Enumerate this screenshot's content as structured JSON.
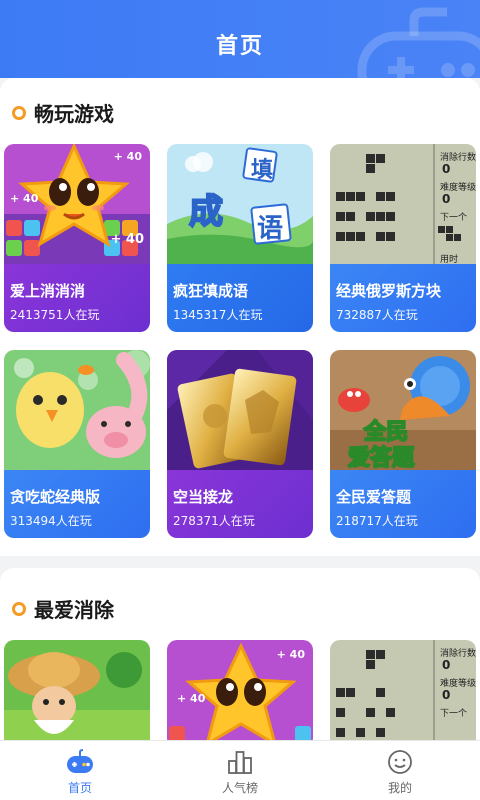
{
  "header": {
    "title": "首页"
  },
  "sections": [
    {
      "title": "畅玩游戏",
      "games": [
        {
          "name": "爱上消消消",
          "players": "2413751人在玩"
        },
        {
          "name": "疯狂填成语",
          "players": "1345317人在玩"
        },
        {
          "name": "经典俄罗斯方块",
          "players": "732887人在玩"
        },
        {
          "name": "贪吃蛇经典版",
          "players": "313494人在玩"
        },
        {
          "name": "空当接龙",
          "players": "278371人在玩"
        },
        {
          "name": "全民爱答题",
          "players": "218717人在玩"
        }
      ]
    },
    {
      "title": "最爱消除"
    }
  ],
  "art_text": {
    "plus40": "+ 40",
    "idiom": [
      "成",
      "填",
      "语"
    ],
    "tetris_labels": [
      "消除行数",
      "0",
      "难度等级",
      "0",
      "下一个",
      "用时"
    ],
    "quiz": [
      "全民",
      "爱答题"
    ]
  },
  "nav": [
    {
      "label": "首页",
      "icon": "gamepad-icon",
      "active": true
    },
    {
      "label": "人气榜",
      "icon": "bar-chart-icon",
      "active": false
    },
    {
      "label": "我的",
      "icon": "smiley-icon",
      "active": false
    }
  ],
  "colors": {
    "primary": "#3d7bf5",
    "accent": "#f59a23",
    "card_purple": "#7a33d6",
    "card_blue": "#2e72ee"
  }
}
